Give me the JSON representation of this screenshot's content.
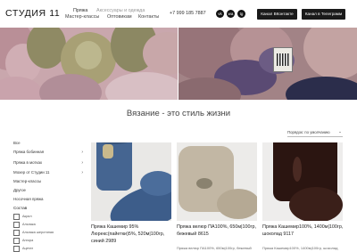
{
  "header": {
    "logo": "СТУДИЯ 11",
    "nav": [
      {
        "label": "Пряжа"
      },
      {
        "label": "Аксессуары и одежда"
      },
      {
        "label": "Мастер-классы"
      },
      {
        "label": "Оптовикам"
      },
      {
        "label": "Контакты"
      }
    ],
    "phone": "+7 999 185 7887",
    "social": [
      {
        "label": "vk",
        "icon": "vk-icon"
      },
      {
        "label": "wa",
        "icon": "whatsapp-icon"
      },
      {
        "label": "tg",
        "icon": "telegram-icon"
      }
    ],
    "btn_vk": "Канал ВКонтакте",
    "btn_tg": "Канал в Телеграмм"
  },
  "tagline": "Вязание - это стиль жизни",
  "sort": {
    "label": "Порядок: по умолчанию",
    "arrow": "⌄"
  },
  "sidebar": {
    "categories": [
      {
        "label": "Все",
        "arrow": ""
      },
      {
        "label": "Пряжа бобинная",
        "arrow": "›"
      },
      {
        "label": "Пряжа в мотках",
        "arrow": "›"
      },
      {
        "label": "Мохер от Студии 11",
        "arrow": "›"
      },
      {
        "label": "Мастер-классы",
        "arrow": ""
      },
      {
        "label": "Другое",
        "arrow": ""
      },
      {
        "label": "Носочная пряжа",
        "arrow": ""
      }
    ],
    "filter_title": "Состав",
    "filters": [
      {
        "label": "Акрил"
      },
      {
        "label": "Альпака"
      },
      {
        "label": "Альпака шерстяная"
      },
      {
        "label": "Ангора"
      },
      {
        "label": "Ацетат"
      }
    ]
  },
  "products": [
    {
      "name": "Пряжа Кашемир 95% Люрекс(пайетки)5%, 520м|100гр, синий 2989",
      "sub": "",
      "color": "#3f5f8c"
    },
    {
      "name": "Пряжа велюр ПА100%, 650м|100гр, бежевый 8615",
      "sub": "Пряжа велюр ПА100%, 650м|100гр, бежевый",
      "color": "#bfb3a1"
    },
    {
      "name": "Пряжа Кашемир100%, 1400м|100гр, шоколад 9117",
      "sub": "Пряжа Кашемир100%, 1400м|100гр, шоколад",
      "color": "#2c1713"
    }
  ]
}
